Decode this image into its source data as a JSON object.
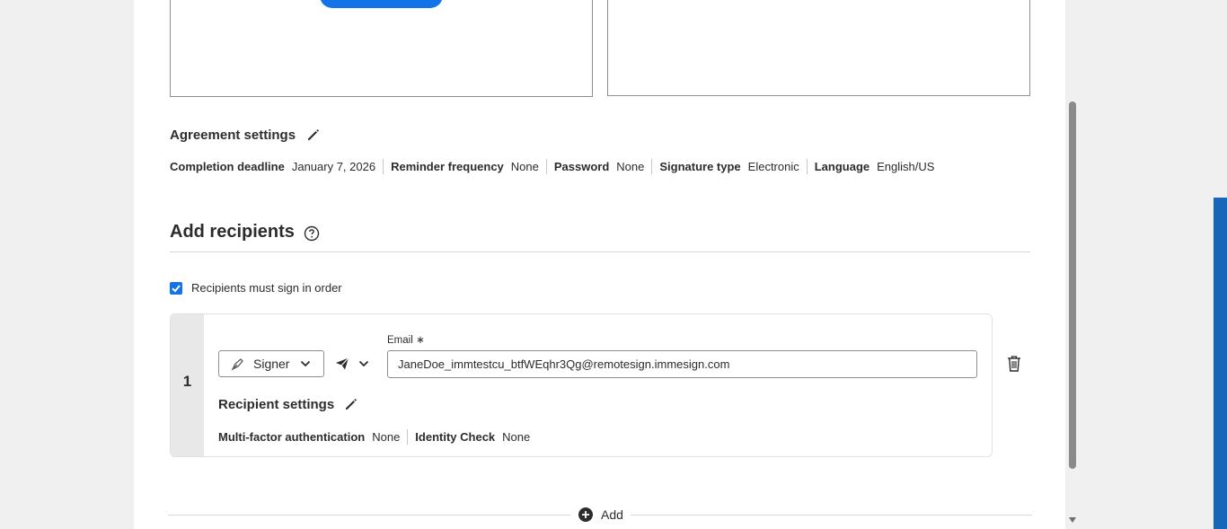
{
  "agreement_settings": {
    "title": "Agreement settings",
    "items": [
      {
        "label": "Completion deadline",
        "value": "January 7, 2026"
      },
      {
        "label": "Reminder frequency",
        "value": "None"
      },
      {
        "label": "Password",
        "value": "None"
      },
      {
        "label": "Signature type",
        "value": "Electronic"
      },
      {
        "label": "Language",
        "value": "English/US"
      }
    ]
  },
  "recipients": {
    "title": "Add recipients",
    "sign_in_order_label": "Recipients must sign in order",
    "sign_in_order_checked": true,
    "list": [
      {
        "order": "1",
        "role": "Signer",
        "email_label": "Email",
        "email_required_mark": "∗",
        "email": "JaneDoe_immtestcu_btfWEqhr3Qg@remotesign.immesign.com",
        "settings_title": "Recipient settings",
        "settings": [
          {
            "label": "Multi-factor authentication",
            "value": "None"
          },
          {
            "label": "Identity Check",
            "value": "None"
          }
        ]
      }
    ],
    "add_label": "Add"
  },
  "colors": {
    "accent": "#1473e6",
    "side_bar": "#1866b8"
  },
  "icons": [
    "pencil-icon",
    "help-circle-icon",
    "checkmark-icon",
    "pen-nib-icon",
    "chevron-down-icon",
    "send-icon",
    "trash-icon",
    "plus-circle-icon"
  ]
}
